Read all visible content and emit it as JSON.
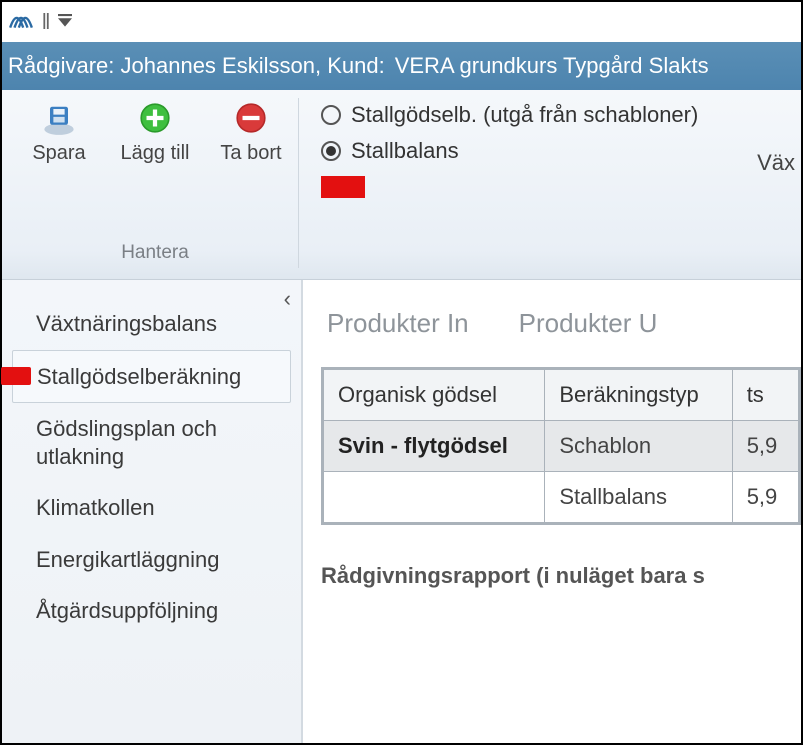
{
  "titlebar": {
    "advisor_label": "Rådgivare:",
    "advisor_name": "Johannes Eskilsson,",
    "customer_label": "Kund:",
    "customer_name": "VERA grundkurs Typgård Slakts"
  },
  "ribbon": {
    "save": "Spara",
    "add": "Lägg till",
    "remove": "Ta bort",
    "group_label": "Hantera",
    "radio1": "Stallgödselb. (utgå från schabloner)",
    "radio2": "Stallbalans",
    "right_label": "Väx"
  },
  "sidebar": {
    "items": [
      "Växtnäringsbalans",
      "Stallgödselberäkning",
      "Gödslingsplan och utlakning",
      "Klimatkollen",
      "Energikartläggning",
      "Åtgärdsuppföljning"
    ]
  },
  "content": {
    "tabs": [
      "Produkter In",
      "Produkter U"
    ],
    "table": {
      "headers": [
        "Organisk gödsel",
        "Beräkningstyp",
        "ts"
      ],
      "rows": [
        {
          "c0": "Svin - flytgödsel",
          "c1": "Schablon",
          "c2": "5,9"
        },
        {
          "c0": "",
          "c1": "Stallbalans",
          "c2": "5,9"
        }
      ]
    },
    "report_label": "Rådgivningsrapport (i nuläget bara s"
  }
}
